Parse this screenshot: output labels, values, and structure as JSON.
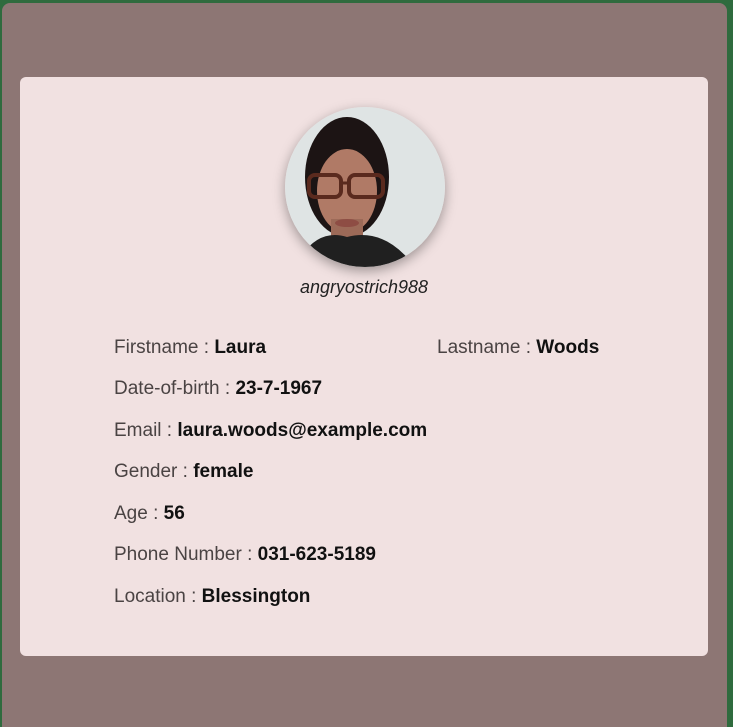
{
  "profile": {
    "username": "angryostrich988",
    "fields": {
      "firstname": {
        "label": "Firstname : ",
        "value": "Laura"
      },
      "lastname": {
        "label": "Lastname : ",
        "value": "Woods"
      },
      "dob": {
        "label": "Date-of-birth : ",
        "value": "23-7-1967"
      },
      "email": {
        "label": "Email : ",
        "value": "laura.woods@example.com"
      },
      "gender": {
        "label": "Gender : ",
        "value": "female"
      },
      "age": {
        "label": "Age : ",
        "value": "56"
      },
      "phone": {
        "label": "Phone Number : ",
        "value": "031-623-5189"
      },
      "location": {
        "label": "Location : ",
        "value": "Blessington"
      }
    }
  },
  "colors": {
    "outer_border": "#2f6b3e",
    "frame_bg": "#8d7674",
    "card_bg": "#f1e1e1"
  }
}
